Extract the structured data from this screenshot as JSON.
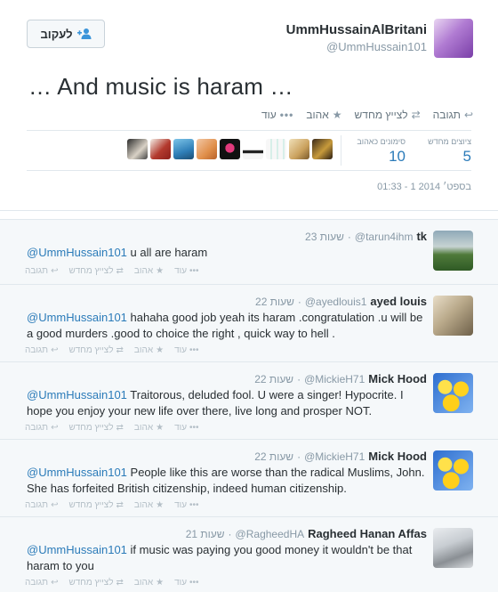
{
  "main_tweet": {
    "display_name": "UmmHussainAlBritani",
    "screen_name": "@UmmHussain101",
    "follow_label": "לעקוב",
    "text": "… And music is haram …",
    "actions": {
      "reply": "תגובה",
      "retweet": "לצייץ מחדש",
      "favorite": "אהוב",
      "more": "עוד",
      "more_dots": "•••"
    },
    "stats": {
      "retweets_label": "ציוצים מחדש",
      "retweets_count": "5",
      "favorites_label": "סימונים כאהוב",
      "favorites_count": "10"
    },
    "timestamp": "01:33 - 1 בספט׳ 2014"
  },
  "reply_actions": {
    "reply": "תגובה",
    "retweet": "לצייץ מחדש",
    "favorite": "אהוב",
    "more": "עוד",
    "more_dots": "•••"
  },
  "replies": [
    {
      "name": "tk",
      "handle": "@tarun4ihm",
      "time": "23 שעות",
      "mention": "@UmmHussain101",
      "text": " u all are haram"
    },
    {
      "name": "ayed louis",
      "handle": "@ayedlouis1",
      "time": "22 שעות",
      "mention": "@UmmHussain101",
      "text": " hahaha good job yeah its haram .congratulation .u will be a good murders .good to choice the right , quick way to hell ."
    },
    {
      "name": "Mick Hood",
      "handle": "@MickieH71",
      "time": "22 שעות",
      "mention": "@UmmHussain101",
      "text": " Traitorous, deluded fool. U were a singer! Hypocrite. I hope you enjoy your new life over there, live long and prosper NOT."
    },
    {
      "name": "Mick Hood",
      "handle": "@MickieH71",
      "time": "22 שעות",
      "mention": "@UmmHussain101",
      "text": " People like this are worse than the radical Muslims, John. She has forfeited British citizenship, indeed human citizenship."
    },
    {
      "name": "Ragheed Hanan Affas",
      "handle": "@RagheedHA",
      "time": "21 שעות",
      "mention": "@UmmHussain101",
      "text": " if music was paying you good money it wouldn't be that haram to you"
    }
  ],
  "colors": {
    "link": "#2b7bb9",
    "muted": "#8899a6",
    "reply_bg": "#f5f8fa"
  }
}
